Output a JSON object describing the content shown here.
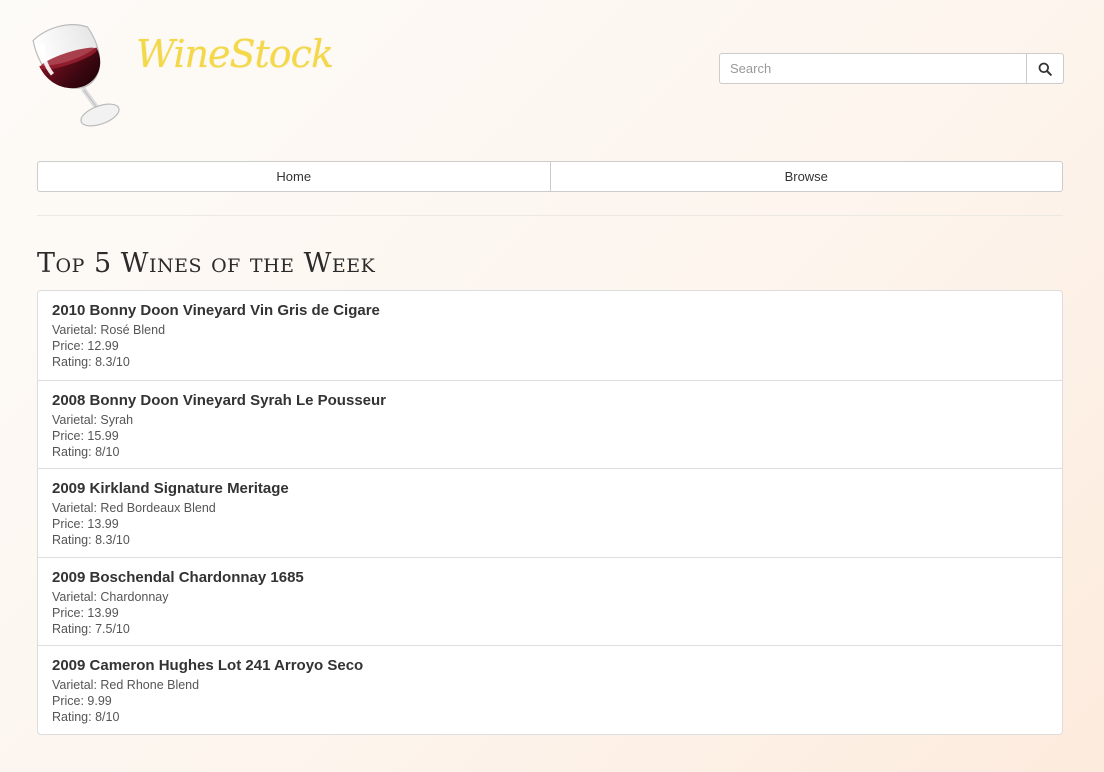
{
  "brand": {
    "name": "WineStock"
  },
  "search": {
    "placeholder": "Search",
    "icon": "search-icon"
  },
  "nav": {
    "items": [
      {
        "label": "Home"
      },
      {
        "label": "Browse"
      }
    ]
  },
  "section": {
    "title": "Top 5 Wines of the Week"
  },
  "wines": [
    {
      "title": "2010 Bonny Doon Vineyard Vin Gris de Cigare",
      "varietal": "Varietal: Rosé Blend",
      "price": "Price: 12.99",
      "rating": "Rating: 8.3/10"
    },
    {
      "title": "2008 Bonny Doon Vineyard Syrah Le Pousseur",
      "varietal": "Varietal: Syrah",
      "price": "Price: 15.99",
      "rating": "Rating: 8/10"
    },
    {
      "title": "2009 Kirkland Signature Meritage",
      "varietal": "Varietal: Red Bordeaux Blend",
      "price": "Price: 13.99",
      "rating": "Rating: 8.3/10"
    },
    {
      "title": "2009 Boschendal Chardonnay 1685",
      "varietal": "Varietal: Chardonnay",
      "price": "Price: 13.99",
      "rating": "Rating: 7.5/10"
    },
    {
      "title": "2009 Cameron Hughes Lot 241 Arroyo Seco",
      "varietal": "Varietal: Red Rhone Blend",
      "price": "Price: 9.99",
      "rating": "Rating: 8/10"
    }
  ]
}
